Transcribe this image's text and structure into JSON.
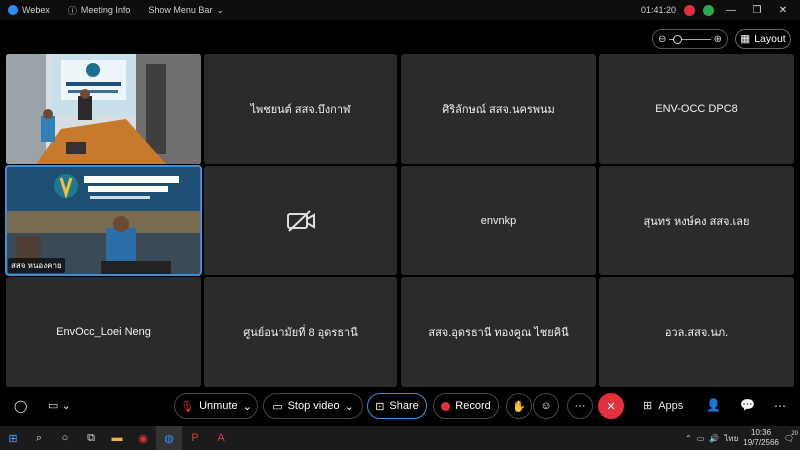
{
  "titlebar": {
    "app_name": "Webex",
    "meeting_info": "Meeting Info",
    "show_menu": "Show Menu Bar",
    "timer": "01:41:20",
    "colors": {
      "red": "#e0313c",
      "green": "#2fa84f"
    }
  },
  "toolbar_top": {
    "zoom_out_icon": "zoom-out",
    "zoom_in_icon": "zoom-in",
    "layout_label": "Layout"
  },
  "tiles": [
    {
      "name": "",
      "video": true,
      "label": ""
    },
    {
      "name": "ไพชยนต์ สสจ.บึงกาฬ",
      "video": false
    },
    {
      "name": "ศิริลักษณ์ สสจ.นครพนม",
      "video": false
    },
    {
      "name": "ENV-OCC DPC8",
      "video": false
    },
    {
      "name": "",
      "video": true,
      "label": "สสจ หนองคาย"
    },
    {
      "name": "",
      "video": false,
      "camera_off": true
    },
    {
      "name": "envnkp",
      "video": false
    },
    {
      "name": "สุนทร หงษ์คง สสจ.เลย",
      "video": false
    },
    {
      "name": "EnvOcc_Loei Neng",
      "video": false
    },
    {
      "name": "ศูนย์อนามัยที่ 8 อุดรธานี",
      "video": false
    },
    {
      "name": "สสจ.อุดรธานี ทองคูณ ไชยคินี",
      "video": false
    },
    {
      "name": "อวล.สสจ.นภ.",
      "video": false
    }
  ],
  "controls": {
    "unmute": "Unmute",
    "stop_video": "Stop video",
    "share": "Share",
    "record": "Record",
    "more": "···",
    "apps": "Apps",
    "colors": {
      "end": "#e0313c",
      "record": "#e0313c"
    }
  },
  "taskbar": {
    "time": "10:36",
    "date": "19/7/2566",
    "lang": "ไทย",
    "notifications": "20"
  }
}
